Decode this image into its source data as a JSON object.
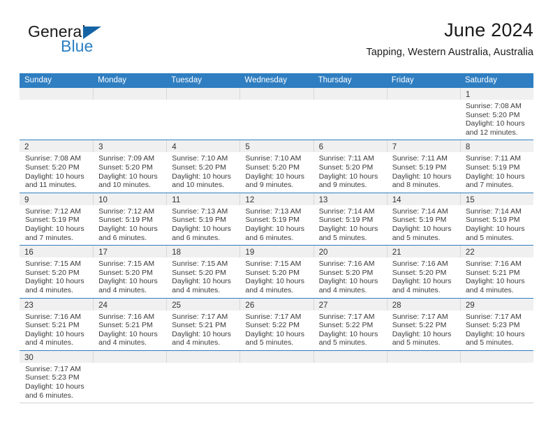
{
  "brand": {
    "name_top": "General",
    "name_bottom": "Blue",
    "triangle_color": "#1464a5",
    "blue_color": "#2a7fc4"
  },
  "header": {
    "title": "June 2024",
    "subtitle": "Tapping, Western Australia, Australia"
  },
  "theme": {
    "header_blue": "#2f7ec1",
    "daynum_band": "#f0f0f0",
    "text": "#3a3a3a"
  },
  "weekdays": [
    "Sunday",
    "Monday",
    "Tuesday",
    "Wednesday",
    "Thursday",
    "Friday",
    "Saturday"
  ],
  "labels": {
    "sunrise": "Sunrise:",
    "sunset": "Sunset:",
    "daylight": "Daylight:"
  },
  "weeks": [
    [
      {
        "day": "",
        "lines": [
          "",
          "",
          "",
          ""
        ]
      },
      {
        "day": "",
        "lines": [
          "",
          "",
          "",
          ""
        ]
      },
      {
        "day": "",
        "lines": [
          "",
          "",
          "",
          ""
        ]
      },
      {
        "day": "",
        "lines": [
          "",
          "",
          "",
          ""
        ]
      },
      {
        "day": "",
        "lines": [
          "",
          "",
          "",
          ""
        ]
      },
      {
        "day": "",
        "lines": [
          "",
          "",
          "",
          ""
        ]
      },
      {
        "day": "1",
        "lines": [
          "Sunrise: 7:08 AM",
          "Sunset: 5:20 PM",
          "Daylight: 10 hours",
          "and 12 minutes."
        ]
      }
    ],
    [
      {
        "day": "2",
        "lines": [
          "Sunrise: 7:08 AM",
          "Sunset: 5:20 PM",
          "Daylight: 10 hours",
          "and 11 minutes."
        ]
      },
      {
        "day": "3",
        "lines": [
          "Sunrise: 7:09 AM",
          "Sunset: 5:20 PM",
          "Daylight: 10 hours",
          "and 10 minutes."
        ]
      },
      {
        "day": "4",
        "lines": [
          "Sunrise: 7:10 AM",
          "Sunset: 5:20 PM",
          "Daylight: 10 hours",
          "and 10 minutes."
        ]
      },
      {
        "day": "5",
        "lines": [
          "Sunrise: 7:10 AM",
          "Sunset: 5:20 PM",
          "Daylight: 10 hours",
          "and 9 minutes."
        ]
      },
      {
        "day": "6",
        "lines": [
          "Sunrise: 7:11 AM",
          "Sunset: 5:20 PM",
          "Daylight: 10 hours",
          "and 9 minutes."
        ]
      },
      {
        "day": "7",
        "lines": [
          "Sunrise: 7:11 AM",
          "Sunset: 5:19 PM",
          "Daylight: 10 hours",
          "and 8 minutes."
        ]
      },
      {
        "day": "8",
        "lines": [
          "Sunrise: 7:11 AM",
          "Sunset: 5:19 PM",
          "Daylight: 10 hours",
          "and 7 minutes."
        ]
      }
    ],
    [
      {
        "day": "9",
        "lines": [
          "Sunrise: 7:12 AM",
          "Sunset: 5:19 PM",
          "Daylight: 10 hours",
          "and 7 minutes."
        ]
      },
      {
        "day": "10",
        "lines": [
          "Sunrise: 7:12 AM",
          "Sunset: 5:19 PM",
          "Daylight: 10 hours",
          "and 6 minutes."
        ]
      },
      {
        "day": "11",
        "lines": [
          "Sunrise: 7:13 AM",
          "Sunset: 5:19 PM",
          "Daylight: 10 hours",
          "and 6 minutes."
        ]
      },
      {
        "day": "12",
        "lines": [
          "Sunrise: 7:13 AM",
          "Sunset: 5:19 PM",
          "Daylight: 10 hours",
          "and 6 minutes."
        ]
      },
      {
        "day": "13",
        "lines": [
          "Sunrise: 7:14 AM",
          "Sunset: 5:19 PM",
          "Daylight: 10 hours",
          "and 5 minutes."
        ]
      },
      {
        "day": "14",
        "lines": [
          "Sunrise: 7:14 AM",
          "Sunset: 5:19 PM",
          "Daylight: 10 hours",
          "and 5 minutes."
        ]
      },
      {
        "day": "15",
        "lines": [
          "Sunrise: 7:14 AM",
          "Sunset: 5:19 PM",
          "Daylight: 10 hours",
          "and 5 minutes."
        ]
      }
    ],
    [
      {
        "day": "16",
        "lines": [
          "Sunrise: 7:15 AM",
          "Sunset: 5:20 PM",
          "Daylight: 10 hours",
          "and 4 minutes."
        ]
      },
      {
        "day": "17",
        "lines": [
          "Sunrise: 7:15 AM",
          "Sunset: 5:20 PM",
          "Daylight: 10 hours",
          "and 4 minutes."
        ]
      },
      {
        "day": "18",
        "lines": [
          "Sunrise: 7:15 AM",
          "Sunset: 5:20 PM",
          "Daylight: 10 hours",
          "and 4 minutes."
        ]
      },
      {
        "day": "19",
        "lines": [
          "Sunrise: 7:15 AM",
          "Sunset: 5:20 PM",
          "Daylight: 10 hours",
          "and 4 minutes."
        ]
      },
      {
        "day": "20",
        "lines": [
          "Sunrise: 7:16 AM",
          "Sunset: 5:20 PM",
          "Daylight: 10 hours",
          "and 4 minutes."
        ]
      },
      {
        "day": "21",
        "lines": [
          "Sunrise: 7:16 AM",
          "Sunset: 5:20 PM",
          "Daylight: 10 hours",
          "and 4 minutes."
        ]
      },
      {
        "day": "22",
        "lines": [
          "Sunrise: 7:16 AM",
          "Sunset: 5:21 PM",
          "Daylight: 10 hours",
          "and 4 minutes."
        ]
      }
    ],
    [
      {
        "day": "23",
        "lines": [
          "Sunrise: 7:16 AM",
          "Sunset: 5:21 PM",
          "Daylight: 10 hours",
          "and 4 minutes."
        ]
      },
      {
        "day": "24",
        "lines": [
          "Sunrise: 7:16 AM",
          "Sunset: 5:21 PM",
          "Daylight: 10 hours",
          "and 4 minutes."
        ]
      },
      {
        "day": "25",
        "lines": [
          "Sunrise: 7:17 AM",
          "Sunset: 5:21 PM",
          "Daylight: 10 hours",
          "and 4 minutes."
        ]
      },
      {
        "day": "26",
        "lines": [
          "Sunrise: 7:17 AM",
          "Sunset: 5:22 PM",
          "Daylight: 10 hours",
          "and 5 minutes."
        ]
      },
      {
        "day": "27",
        "lines": [
          "Sunrise: 7:17 AM",
          "Sunset: 5:22 PM",
          "Daylight: 10 hours",
          "and 5 minutes."
        ]
      },
      {
        "day": "28",
        "lines": [
          "Sunrise: 7:17 AM",
          "Sunset: 5:22 PM",
          "Daylight: 10 hours",
          "and 5 minutes."
        ]
      },
      {
        "day": "29",
        "lines": [
          "Sunrise: 7:17 AM",
          "Sunset: 5:23 PM",
          "Daylight: 10 hours",
          "and 5 minutes."
        ]
      }
    ],
    [
      {
        "day": "30",
        "lines": [
          "Sunrise: 7:17 AM",
          "Sunset: 5:23 PM",
          "Daylight: 10 hours",
          "and 6 minutes."
        ]
      },
      {
        "day": "",
        "lines": [
          "",
          "",
          "",
          ""
        ]
      },
      {
        "day": "",
        "lines": [
          "",
          "",
          "",
          ""
        ]
      },
      {
        "day": "",
        "lines": [
          "",
          "",
          "",
          ""
        ]
      },
      {
        "day": "",
        "lines": [
          "",
          "",
          "",
          ""
        ]
      },
      {
        "day": "",
        "lines": [
          "",
          "",
          "",
          ""
        ]
      },
      {
        "day": "",
        "lines": [
          "",
          "",
          "",
          ""
        ]
      }
    ]
  ]
}
